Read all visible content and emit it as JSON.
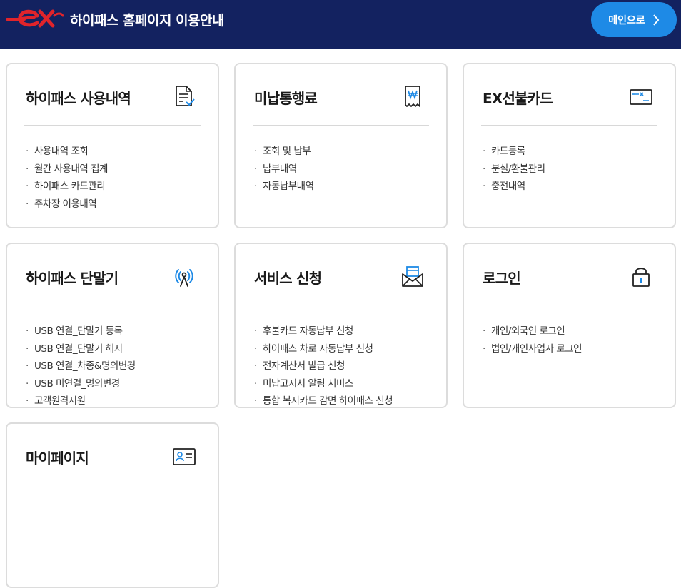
{
  "header": {
    "logo_text": "ex",
    "title": "하이패스 홈페이지 이용안내",
    "main_button_label": "메인으로"
  },
  "colors": {
    "header_bg": "#132260",
    "accent_blue": "#1e8ae6",
    "logo_red": "#e1242b"
  },
  "cards": [
    {
      "title": "하이패스 사용내역",
      "icon": "document-check-icon",
      "items": [
        "사용내역 조회",
        "월간 사용내역 집계",
        "하이패스 카드관리",
        "주차장 이용내역"
      ]
    },
    {
      "title": "미납통행료",
      "icon": "won-receipt-icon",
      "items": [
        "조회 및 납부",
        "납부내역",
        "자동납부내역"
      ]
    },
    {
      "title": "EX선불카드",
      "icon": "ex-card-icon",
      "items": [
        "카드등록",
        "분실/환불관리",
        "충전내역"
      ]
    },
    {
      "title": "하이패스 단말기",
      "icon": "antenna-signal-icon",
      "items": [
        "USB 연결_단말기 등록",
        "USB 연결_단말기 해지",
        "USB 연결_차종&명의변경",
        "USB 미연결_명의변경",
        "고객원격지원"
      ]
    },
    {
      "title": "서비스 신청",
      "icon": "envelope-letter-icon",
      "items": [
        "후불카드 자동납부 신청",
        "하이패스 차로 자동납부 신청",
        "전자계산서 발급 신청",
        "미납고지서 알림 서비스",
        "통합 복지카드 감면 하이패스 신청"
      ]
    },
    {
      "title": "로그인",
      "icon": "lock-icon",
      "items": [
        "개인/외국인 로그인",
        "법인/개인사업자 로그인"
      ]
    },
    {
      "title": "마이페이지",
      "icon": "id-card-icon",
      "items": []
    }
  ]
}
